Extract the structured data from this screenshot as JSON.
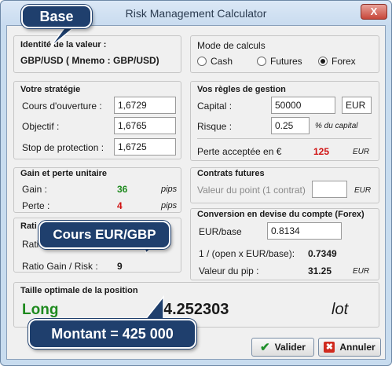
{
  "window": {
    "title": "Risk Management Calculator",
    "close_label": "X"
  },
  "identity": {
    "header": "Identité de la valeur :",
    "value": "GBP/USD ( Mnemo : GBP/USD)"
  },
  "mode": {
    "header": "Mode de calculs",
    "options": [
      "Cash",
      "Futures",
      "Forex"
    ],
    "selected": "Forex"
  },
  "strategy": {
    "header": "Votre stratégie",
    "rows": [
      {
        "label": "Cours d'ouverture :",
        "value": "1,6729"
      },
      {
        "label": "Objectif  :",
        "value": "1,6765"
      },
      {
        "label": "Stop de protection :",
        "value": "1,6725"
      }
    ]
  },
  "rules": {
    "header": "Vos règles de gestion",
    "capital_label": "Capital :",
    "capital_value": "50000",
    "currency": "EUR",
    "risk_label": "Risque :",
    "risk_value": "0.25",
    "risk_unit": "% du capital",
    "loss_label": "Perte acceptée en €",
    "loss_value": "125",
    "loss_unit": "EUR"
  },
  "unit": {
    "header": "Gain et perte unitaire",
    "gain_label": "Gain :",
    "gain_value": "36",
    "loss_label": "Perte :",
    "loss_value": "4",
    "unit_label": "pips"
  },
  "futures": {
    "header": "Contrats futures",
    "point_label": "Valeur du point (1 contrat)",
    "point_value": "",
    "unit": "EUR"
  },
  "ratio": {
    "header_partial": "Rati",
    "row1_partial": "Ratio",
    "row2_label": "Ratio Gain / Risk :",
    "row2_value": "9"
  },
  "conversion": {
    "header": "Conversion en devise du compte (Forex)",
    "rate_label": "EUR/base",
    "rate_value": "0.8134",
    "inverse_label": "1 / (open x EUR/base):",
    "inverse_value": "0.7349",
    "pip_label": "Valeur du pip :",
    "pip_value": "31.25",
    "pip_unit": "EUR"
  },
  "position": {
    "header": "Taille optimale de la position",
    "direction": "Long",
    "size": "4.252303",
    "unit": "lot"
  },
  "buttons": {
    "ok": "Valider",
    "cancel": "Annuler"
  },
  "callouts": {
    "base": "Base",
    "rate": "Cours EUR/GBP",
    "amount": "Montant = 425 000"
  },
  "colors": {
    "callout_bg": "#1f3f6d",
    "gain": "#1e8a1e",
    "loss": "#d01010",
    "long": "#1e8a1e"
  }
}
